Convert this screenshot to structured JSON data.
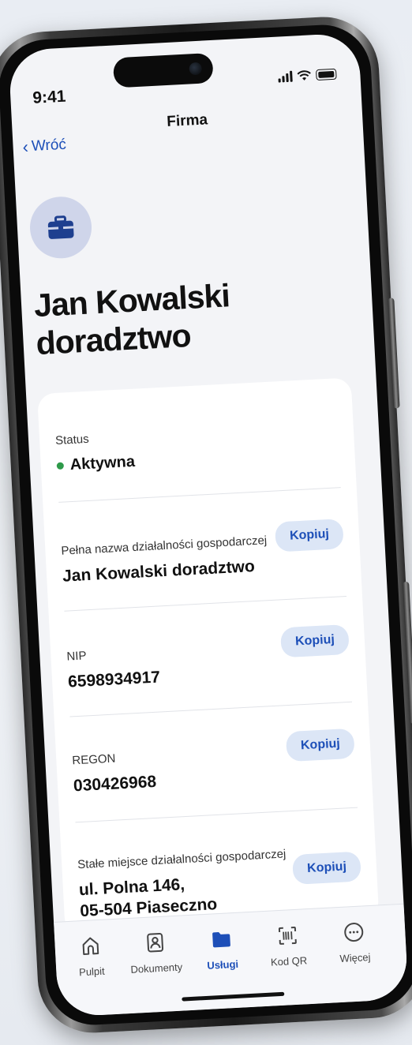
{
  "status_bar": {
    "time": "9:41"
  },
  "nav": {
    "back_label": "Wróć",
    "title": "Firma"
  },
  "business": {
    "name": "Jan Kowalski doradztwo"
  },
  "details": {
    "status": {
      "label": "Status",
      "value": "Aktywna",
      "color": "#2e9a4a"
    },
    "full_name": {
      "label": "Pełna nazwa działalności gospodarczej",
      "value": "Jan Kowalski doradztwo",
      "copy_label": "Kopiuj"
    },
    "nip": {
      "label": "NIP",
      "value": "6598934917",
      "copy_label": "Kopiuj"
    },
    "regon": {
      "label": "REGON",
      "value": "030426968",
      "copy_label": "Kopiuj"
    },
    "address": {
      "label": "Stałe miejsce działalności gospodarczej",
      "line1": "ul. Polna 146,",
      "line2": "05-504 Piaseczno",
      "copy_label": "Kopiuj"
    }
  },
  "tabbar": {
    "items": [
      {
        "label": "Pulpit",
        "icon": "home-icon"
      },
      {
        "label": "Dokumenty",
        "icon": "id-card-icon"
      },
      {
        "label": "Usługi",
        "icon": "folder-icon",
        "active": true
      },
      {
        "label": "Kod QR",
        "icon": "qr-scan-icon"
      },
      {
        "label": "Więcej",
        "icon": "more-icon"
      }
    ]
  },
  "colors": {
    "accent": "#1d4fb8",
    "status_active": "#2e9a4a"
  }
}
